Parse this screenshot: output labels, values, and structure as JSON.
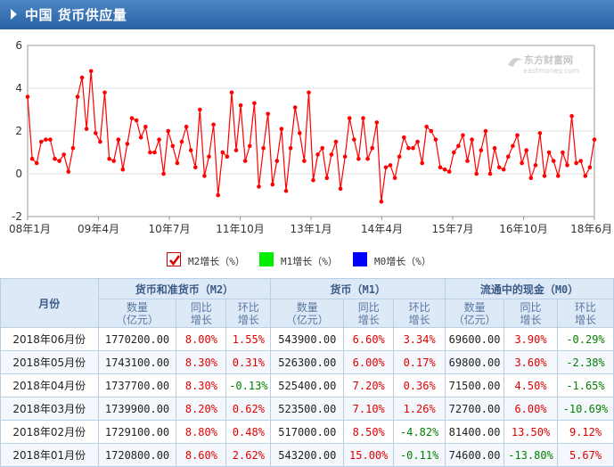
{
  "header": {
    "title": "中国 货币供应量"
  },
  "watermark": {
    "brand": "东方财富网",
    "url": "eastmoney.com"
  },
  "colors": {
    "m2": "#ff0000",
    "m1": "#00ee00",
    "m0": "#0000ff",
    "header": "#2f6aac",
    "positive": "#e00000",
    "negative": "#008000"
  },
  "chart_data": {
    "type": "line",
    "x_ticks": [
      "08年1月",
      "09年4月",
      "10年7月",
      "11年10月",
      "13年1月",
      "14年4月",
      "15年7月",
      "16年10月",
      "18年6月"
    ],
    "ylim": [
      -2,
      6
    ],
    "y_ticks": [
      6,
      4,
      2,
      0,
      -2
    ],
    "grid": true,
    "legend_position": "bottom",
    "series": [
      {
        "name": "M2增长（%）",
        "color": "#ff0000",
        "values": [
          3.6,
          0.7,
          0.5,
          1.5,
          1.6,
          1.6,
          0.7,
          0.6,
          0.9,
          0.1,
          1.2,
          3.6,
          4.5,
          2.1,
          4.8,
          1.9,
          1.5,
          3.8,
          0.7,
          0.6,
          1.6,
          0.2,
          1.4,
          2.6,
          2.5,
          1.7,
          2.2,
          1.0,
          1.0,
          1.6,
          0.0,
          2.0,
          1.3,
          0.5,
          1.5,
          2.2,
          1.1,
          0.3,
          3.0,
          -0.1,
          0.8,
          2.3,
          -1.0,
          1.0,
          0.8,
          3.8,
          1.1,
          3.2,
          0.6,
          1.3,
          3.3,
          -0.6,
          1.2,
          2.8,
          -0.5,
          0.6,
          2.1,
          -0.8,
          1.2,
          3.1,
          1.9,
          0.6,
          3.8,
          -0.3,
          0.9,
          1.2,
          -0.2,
          0.9,
          1.5,
          -0.7,
          0.8,
          2.6,
          1.6,
          0.7,
          2.6,
          0.7,
          1.2,
          2.4,
          -1.3,
          0.3,
          0.4,
          -0.2,
          0.8,
          1.7,
          1.2,
          1.2,
          1.5,
          0.5,
          2.2,
          2.0,
          1.6,
          0.3,
          0.2,
          0.1,
          1.0,
          1.3,
          1.8,
          0.6,
          1.6,
          0.0,
          1.1,
          2.0,
          0.0,
          1.2,
          0.3,
          0.2,
          0.8,
          1.3,
          1.8,
          0.5,
          1.1,
          -0.2,
          0.4,
          1.9,
          -0.1,
          1.0,
          0.6,
          -0.1,
          1.0,
          0.4,
          2.7,
          0.5,
          0.6,
          -0.1,
          0.3,
          1.6
        ]
      },
      {
        "name": "M1增长（%）",
        "color": "#00ee00",
        "values": []
      },
      {
        "name": "M0增长（%）",
        "color": "#0000ff",
        "values": []
      }
    ]
  },
  "legend": [
    {
      "label": "M2增长（%）",
      "checked": true
    },
    {
      "label": "M1增长（%）",
      "checked": false
    },
    {
      "label": "M0增长（%）",
      "checked": false
    }
  ],
  "table": {
    "month_header": "月份",
    "groups": [
      "货币和准货币（M2）",
      "货币（M1）",
      "流通中的现金（M0）"
    ],
    "sub_headers": [
      [
        "数量",
        "（亿元）"
      ],
      [
        "同比",
        "增长"
      ],
      [
        "环比",
        "增长"
      ]
    ],
    "rows": [
      {
        "month": "2018年06月份",
        "m2": [
          "1770200.00",
          "8.00%",
          "1.55%"
        ],
        "m1": [
          "543900.00",
          "6.60%",
          "3.34%"
        ],
        "m0": [
          "69600.00",
          "3.90%",
          "-0.29%"
        ]
      },
      {
        "month": "2018年05月份",
        "m2": [
          "1743100.00",
          "8.30%",
          "0.31%"
        ],
        "m1": [
          "526300.00",
          "6.00%",
          "0.17%"
        ],
        "m0": [
          "69800.00",
          "3.60%",
          "-2.38%"
        ]
      },
      {
        "month": "2018年04月份",
        "m2": [
          "1737700.00",
          "8.30%",
          "-0.13%"
        ],
        "m1": [
          "525400.00",
          "7.20%",
          "0.36%"
        ],
        "m0": [
          "71500.00",
          "4.50%",
          "-1.65%"
        ]
      },
      {
        "month": "2018年03月份",
        "m2": [
          "1739900.00",
          "8.20%",
          "0.62%"
        ],
        "m1": [
          "523500.00",
          "7.10%",
          "1.26%"
        ],
        "m0": [
          "72700.00",
          "6.00%",
          "-10.69%"
        ]
      },
      {
        "month": "2018年02月份",
        "m2": [
          "1729100.00",
          "8.80%",
          "0.48%"
        ],
        "m1": [
          "517000.00",
          "8.50%",
          "-4.82%"
        ],
        "m0": [
          "81400.00",
          "13.50%",
          "9.12%"
        ]
      },
      {
        "month": "2018年01月份",
        "m2": [
          "1720800.00",
          "8.60%",
          "2.62%"
        ],
        "m1": [
          "543200.00",
          "15.00%",
          "-0.11%"
        ],
        "m0": [
          "74600.00",
          "-13.80%",
          "5.67%"
        ]
      }
    ]
  }
}
